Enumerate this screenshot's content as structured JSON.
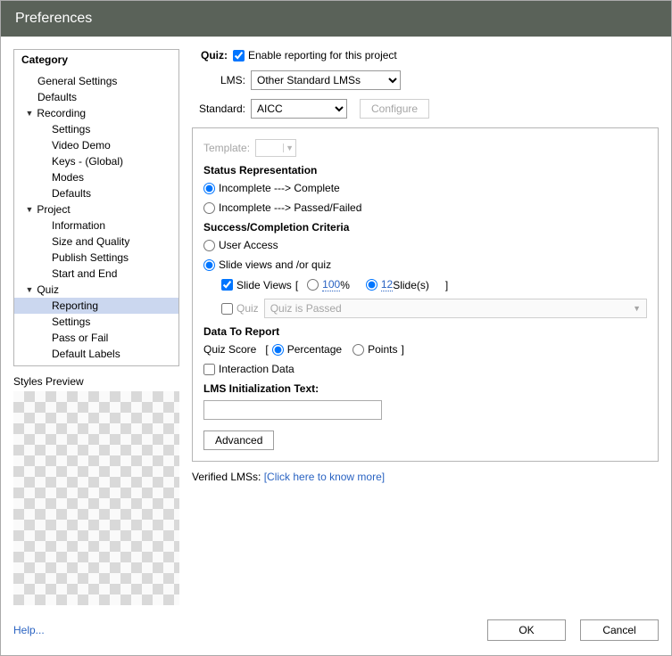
{
  "window": {
    "title": "Preferences"
  },
  "category": {
    "header": "Category",
    "items": {
      "general_settings": "General Settings",
      "defaults_top": "Defaults",
      "recording": "Recording",
      "rec_settings": "Settings",
      "video_demo": "Video Demo",
      "keys_global": "Keys - (Global)",
      "modes": "Modes",
      "rec_defaults": "Defaults",
      "project": "Project",
      "information": "Information",
      "size_quality": "Size and Quality",
      "publish_settings": "Publish Settings",
      "start_end": "Start and End",
      "quiz": "Quiz",
      "reporting": "Reporting",
      "quiz_settings": "Settings",
      "pass_fail": "Pass or Fail",
      "default_labels": "Default Labels"
    }
  },
  "preview": {
    "label": "Styles Preview"
  },
  "quiz": {
    "label": "Quiz:",
    "enable_text": "Enable reporting for this project",
    "enable_checked": true
  },
  "lms": {
    "label": "LMS:",
    "value": "Other Standard LMSs"
  },
  "standard": {
    "label": "Standard:",
    "value": "AICC",
    "configure_btn": "Configure"
  },
  "template": {
    "label": "Template:"
  },
  "status_rep": {
    "title": "Status Representation",
    "opt1": "Incomplete ---> Complete",
    "opt2": "Incomplete ---> Passed/Failed"
  },
  "criteria": {
    "title": "Success/Completion Criteria",
    "user_access": "User Access",
    "slide_views_or_quiz": "Slide views and /or quiz",
    "slide_views_label": "Slide Views",
    "bracket_open": "[",
    "bracket_close": "]",
    "percent_value": "100",
    "percent_suffix": " %",
    "slides_value": "12",
    "slides_suffix": " Slide(s)",
    "quiz_label": "Quiz",
    "quiz_select_value": "Quiz is Passed"
  },
  "data_report": {
    "title": "Data To Report",
    "quiz_score_label": "Quiz Score",
    "percentage": "Percentage",
    "points": "Points",
    "interaction": "Interaction Data"
  },
  "lms_init": {
    "label": "LMS Initialization Text:"
  },
  "advanced_btn": "Advanced",
  "verified": {
    "label": "Verified LMSs:",
    "link": "[Click here to know more]"
  },
  "footer": {
    "help": "Help...",
    "ok": "OK",
    "cancel": "Cancel"
  }
}
